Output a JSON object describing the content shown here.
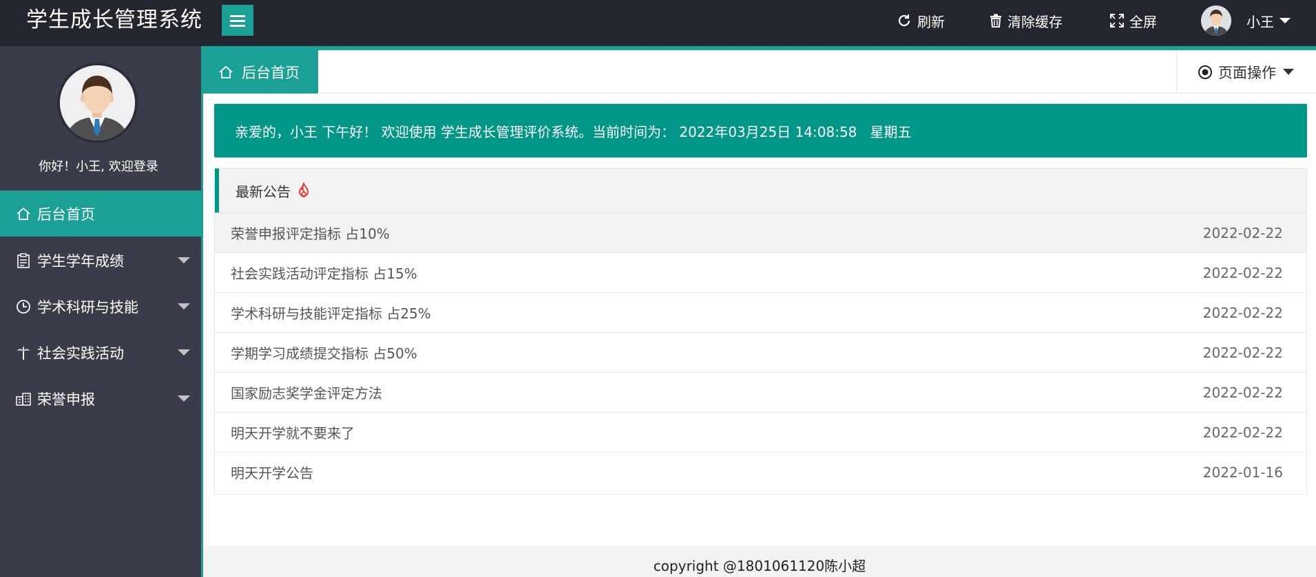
{
  "header": {
    "brand": "学生成长管理系统",
    "refresh_label": "刷新",
    "clear_cache_label": "清除缓存",
    "fullscreen_label": "全屏",
    "user_name": "小王"
  },
  "sidebar": {
    "welcome": "你好！小王, 欢迎登录",
    "items": [
      {
        "label": "后台首页",
        "icon": "home-icon"
      },
      {
        "label": "学生学年成绩",
        "icon": "clipboard-icon"
      },
      {
        "label": "学术科研与技能",
        "icon": "clock-icon"
      },
      {
        "label": "社会实践活动",
        "icon": "palm-tree-icon"
      },
      {
        "label": "荣誉申报",
        "icon": "buildings-icon"
      }
    ]
  },
  "tabs": {
    "home_label": "后台首页",
    "page_ops_label": "页面操作"
  },
  "banner": {
    "text": "亲爱的，小王 下午好！ 欢迎使用 学生成长管理评价系统。当前时间为： 2022年03月25日 14:08:58   星期五"
  },
  "notices": {
    "title": "最新公告",
    "items": [
      {
        "title": "荣誉申报评定指标 占10%",
        "date": "2022-02-22"
      },
      {
        "title": "社会实践活动评定指标 占15%",
        "date": "2022-02-22"
      },
      {
        "title": "学术科研与技能评定指标 占25%",
        "date": "2022-02-22"
      },
      {
        "title": "学期学习成绩提交指标 占50%",
        "date": "2022-02-22"
      },
      {
        "title": "国家励志奖学金评定方法",
        "date": "2022-02-22"
      },
      {
        "title": "明天开学就不要来了",
        "date": "2022-02-22"
      },
      {
        "title": "明天开学公告",
        "date": "2022-01-16"
      }
    ]
  },
  "footer": {
    "text": "copyright @1801061120陈小超"
  },
  "colors": {
    "accent": "#009688",
    "accent_light": "#1aa094",
    "header_bg": "#23262e",
    "sidebar_bg": "#3a3d49"
  }
}
